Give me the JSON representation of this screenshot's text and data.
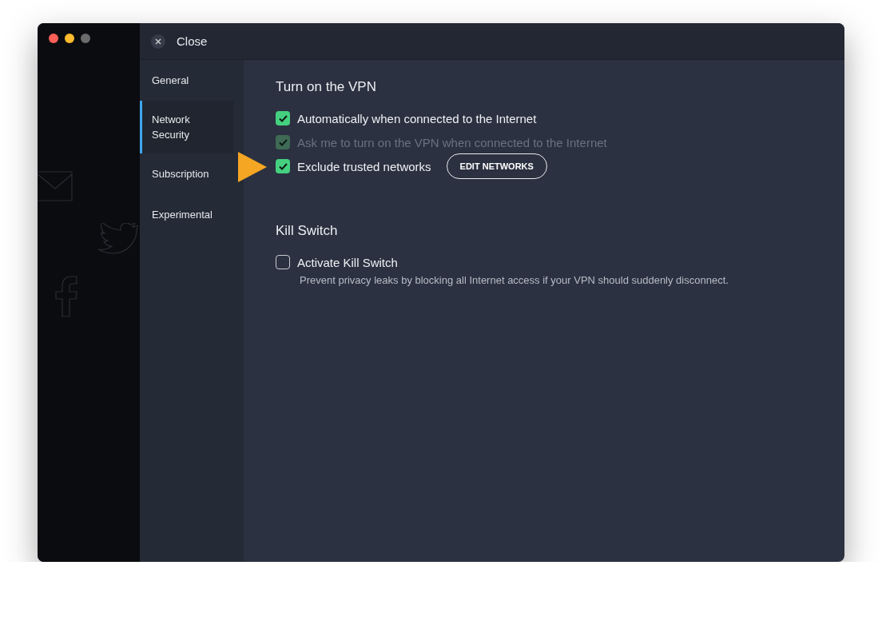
{
  "window": {
    "close_label": "Close"
  },
  "sidebar": {
    "items": [
      {
        "label": "General",
        "selected": false
      },
      {
        "label": "Network Security",
        "selected": true
      },
      {
        "label": "Subscription",
        "selected": false
      },
      {
        "label": "Experimental",
        "selected": false
      }
    ]
  },
  "sections": [
    {
      "title": "Turn on the VPN",
      "options": [
        {
          "label": "Automatically when connected to the Internet",
          "checked": true,
          "disabled": false
        },
        {
          "label": "Ask me to turn on the VPN when connected to the Internet",
          "checked": true,
          "disabled": true
        },
        {
          "label": "Exclude trusted networks",
          "checked": true,
          "disabled": false,
          "button": "EDIT NETWORKS",
          "pointer": true
        }
      ]
    },
    {
      "title": "Kill Switch",
      "options": [
        {
          "label": "Activate Kill Switch",
          "checked": false,
          "disabled": false,
          "description": "Prevent privacy leaks by blocking all Internet access if your VPN should suddenly disconnect."
        }
      ]
    }
  ]
}
